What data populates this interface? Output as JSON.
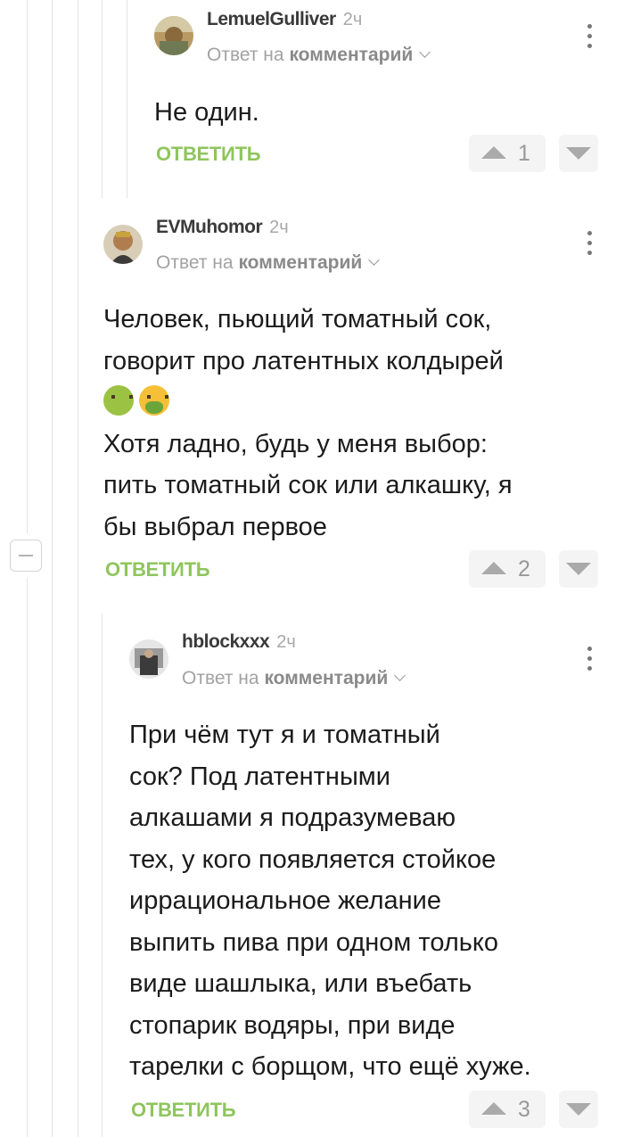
{
  "comments": [
    {
      "username": "LemuelGulliver",
      "time": "2ч",
      "reply_prefix": "Ответ на",
      "reply_target": "комментарий",
      "text": [
        "Не один."
      ],
      "reply_label": "ОТВЕТИТЬ",
      "rating": "1"
    },
    {
      "username": "EVMuhomor",
      "time": "2ч",
      "reply_prefix": "Ответ на",
      "reply_target": "комментарий",
      "text": [
        "Человек, пьющий томатный сок,",
        "говорит про латентных колдырей",
        "",
        "Хотя ладно, будь у меня выбор:",
        "пить томатный сок или алкашку, я",
        "бы выбрал первое"
      ],
      "emojis": [
        "nauseated-face-emoji",
        "face-vomiting-emoji"
      ],
      "reply_label": "ОТВЕТИТЬ",
      "rating": "2"
    },
    {
      "username": "hblockxxx",
      "time": "2ч",
      "reply_prefix": "Ответ на",
      "reply_target": "комментарий",
      "text": [
        "При чём тут я и томатный",
        "сок? Под латентными",
        "алкашами я подразумеваю",
        "тех, у кого появляется стойкое",
        "иррациональное желание",
        "выпить пива при одном только",
        "виде шашлыка, или въебать",
        "стопарик водяры, при виде",
        "тарелки с борщом, что ещё хуже."
      ],
      "reply_label": "ОТВЕТИТЬ",
      "rating": "3"
    }
  ],
  "colors": {
    "accent_green": "#8fc55d",
    "vote_bg": "#f4f4f4",
    "vote_arrow": "#aaaaaa"
  },
  "icons": [
    "chevron-down-icon",
    "kebab-menu-icon",
    "upvote-icon",
    "downvote-icon",
    "collapse-thread-icon"
  ]
}
